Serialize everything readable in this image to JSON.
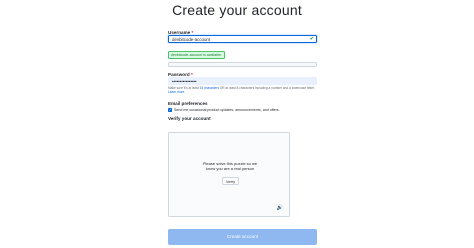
{
  "page": {
    "title": "Create your account"
  },
  "username": {
    "label": "Username",
    "required_mark": "*",
    "value": "devbitcode-account",
    "status_text": "devbitcode-account is available."
  },
  "password": {
    "label": "Password",
    "required_mark": "*",
    "value": "••••••••••••••••",
    "hint_prefix": "Make sure it's at least ",
    "hint_link": "15 characters",
    "hint_rest": " OR at least 8 characters including a number and a lowercase letter.",
    "learn_more": "Learn more."
  },
  "email_prefs": {
    "label": "Email preferences",
    "checkbox_checked": true,
    "checkbox_label": "Send me occasional product updates, announcements, and offers."
  },
  "verify": {
    "label": "Verify your account",
    "puzzle_line1": "Please solve this puzzle so we",
    "puzzle_line2": "know you are a real person",
    "verify_button": "Verify",
    "audio_icon": "speaker-icon"
  },
  "submit": {
    "label": "Create account"
  },
  "colors": {
    "accent": "#0969da",
    "success": "#1a7f37",
    "button_disabled": "#8fb8f0"
  }
}
